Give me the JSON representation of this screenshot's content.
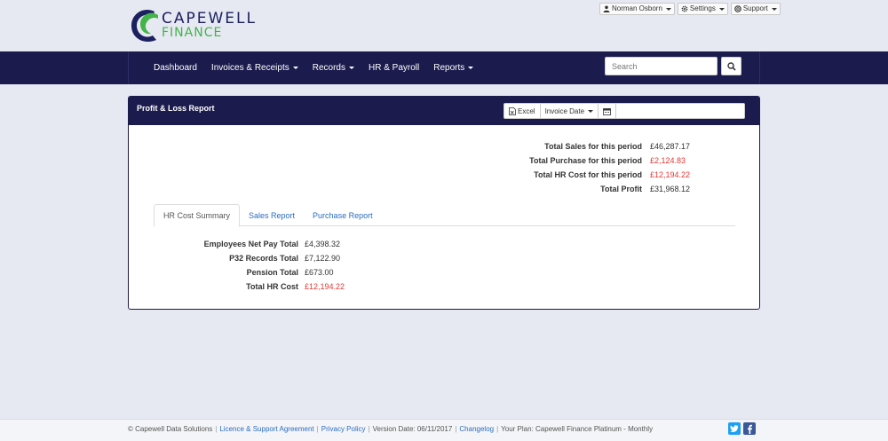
{
  "brand": {
    "name_line1": "CAPEWELL",
    "name_line2": "FINANCE",
    "colors": {
      "navy": "#1b1b4e",
      "green": "#44b34a"
    }
  },
  "user_menu": {
    "user": "Norman Osborn",
    "settings": "Settings",
    "support": "Support"
  },
  "nav": {
    "items": [
      {
        "label": "Dashboard",
        "dropdown": false
      },
      {
        "label": "Invoices & Receipts",
        "dropdown": true
      },
      {
        "label": "Records",
        "dropdown": true
      },
      {
        "label": "HR & Payroll",
        "dropdown": false
      },
      {
        "label": "Reports",
        "dropdown": true
      }
    ],
    "search_placeholder": "Search"
  },
  "panel": {
    "title": "Profit & Loss Report",
    "excel_label": "Excel",
    "date_filter_label": "Invoice Date",
    "date_value": ""
  },
  "totals": [
    {
      "label": "Total Sales for this period",
      "value": "£46,287.17",
      "color": "#333333"
    },
    {
      "label": "Total Purchase for this period",
      "value": "£2,124.83",
      "color": "#e53935"
    },
    {
      "label": "Total HR Cost for this period",
      "value": "£12,194.22",
      "color": "#e53935"
    },
    {
      "label": "Total Profit",
      "value": "£31,968.12",
      "color": "#333333"
    }
  ],
  "tabs": [
    {
      "label": "HR Cost Summary",
      "active": true
    },
    {
      "label": "Sales Report",
      "active": false
    },
    {
      "label": "Purchase Report",
      "active": false
    }
  ],
  "hr_summary": [
    {
      "label": "Employees Net Pay Total",
      "value": "£4,398.32",
      "color": "#333333"
    },
    {
      "label": "P32 Records Total",
      "value": "£7,122.90",
      "color": "#333333"
    },
    {
      "label": "Pension Total",
      "value": "£673.00",
      "color": "#333333"
    },
    {
      "label": "Total HR Cost",
      "value": "£12,194.22",
      "color": "#e53935"
    }
  ],
  "footer": {
    "copyright": "© Capewell Data Solutions",
    "licence_link": "Licence & Support Agreement",
    "privacy_link": "Privacy Policy",
    "version": "Version Date: 06/11/2017",
    "changelog_link": "Changelog",
    "plan": "Your Plan: Capewell Finance Platinum - Monthly"
  },
  "social": {
    "twitter_color": "#1da1f2",
    "facebook_color": "#3b5998"
  }
}
